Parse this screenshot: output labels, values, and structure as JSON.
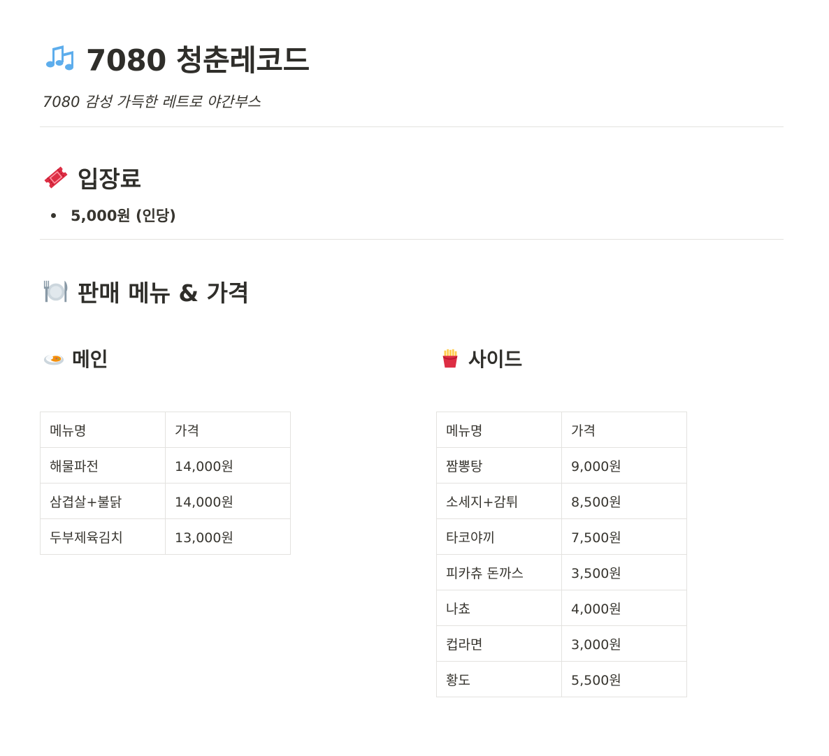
{
  "header": {
    "icon": "musical-notes-icon",
    "title": "7080 청춘레코드",
    "subtitle": "7080 감성 가득한 레트로 야간부스"
  },
  "admission": {
    "icon": "ticket-icon",
    "heading": "입장료",
    "items": [
      "5,000원 (인당)"
    ]
  },
  "menu_section": {
    "icon": "plate-fork-knife-icon",
    "heading": "판매 메뉴 & 가격",
    "main": {
      "icon": "curry-plate-icon",
      "heading": "메인",
      "columns": [
        "메뉴명",
        "가격"
      ],
      "rows": [
        [
          "해물파전",
          "14,000원"
        ],
        [
          "삼겹살+불닭",
          "14,000원"
        ],
        [
          "두부제육김치",
          "13,000원"
        ]
      ]
    },
    "side": {
      "icon": "french-fries-icon",
      "heading": "사이드",
      "columns": [
        "메뉴명",
        "가격"
      ],
      "rows": [
        [
          "짬뽕탕",
          "9,000원"
        ],
        [
          "소세지+감튀",
          "8,500원"
        ],
        [
          "타코야끼",
          "7,500원"
        ],
        [
          "피카츄 돈까스",
          "3,500원"
        ],
        [
          "나쵸",
          "4,000원"
        ],
        [
          "컵라면",
          "3,000원"
        ],
        [
          "황도",
          "5,500원"
        ]
      ]
    }
  },
  "colors": {
    "text": "#37352f",
    "divider": "#e3e2df",
    "note_blue": "#5dadec",
    "ticket_red": "#dd2e44",
    "fries_red": "#dd2e44",
    "fries_yellow": "#ffcc4d"
  }
}
